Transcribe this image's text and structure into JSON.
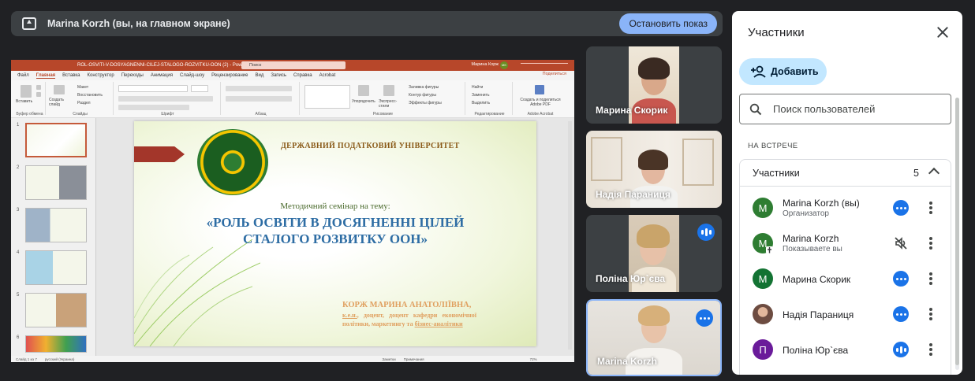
{
  "presenting_bar": {
    "text": "Marina Korzh (вы, на главном экране)",
    "stop_button": "Остановить показ"
  },
  "shared_screen": {
    "window_title": "ROL-OSVITI-V-DOSYAGNENNI-CILEJ-STALOGO-ROZVITKU-OON (2)",
    "app_name": "PowerPoint",
    "search_placeholder": "Поиск",
    "user_name": "Марина Корж",
    "user_initials": "MK",
    "share_button": "Поделиться",
    "tabs": [
      "Файл",
      "Главная",
      "Вставка",
      "Конструктор",
      "Переходы",
      "Анимация",
      "Слайд-шоу",
      "Рецензирование",
      "Вид",
      "Запись",
      "Справка",
      "Acrobat"
    ],
    "active_tab": "Главная",
    "ribbon_groups": [
      "Буфер обмена",
      "Слайды",
      "Шрифт",
      "Абзац",
      "Рисование",
      "Редактирование",
      "Adobe Acrobat"
    ],
    "ribbon_items": {
      "paste": "Вставить",
      "new_slide": "Создать слайд",
      "layout": "Макет",
      "reset": "Восстановить",
      "section": "Раздел",
      "arrange": "Упорядочить",
      "styles": "Экспресс-стили",
      "find": "Найти",
      "replace": "Заменить",
      "select": "Выделить",
      "acrobat": "Создать и поделиться Adobe PDF",
      "fill": "Заливка фигуры",
      "outline": "Контур фигуры",
      "effects": "Эффекты фигуры"
    },
    "thumb_numbers": [
      "1",
      "2",
      "3",
      "4",
      "5",
      "6"
    ],
    "slide": {
      "university": "ДЕРЖАВНИЙ ПОДАТКОВИЙ УНІВЕРСИТЕТ",
      "subtitle": "Методичний семінар на тему:",
      "title_line1": "«РОЛЬ ОСВІТИ В ДОСЯГНЕННІ ЦІЛЕЙ",
      "title_line2": "СТАЛОГО РОЗВИТКУ ООН»",
      "author": "КОРЖ МАРИНА АНАТОЛІЇВНА,",
      "degree": "к.е.н.",
      "info": ", доцент, доцент кафедри економічної політики, маркетингу та",
      "department_link": "бізнес-аналітики"
    },
    "status_bar": {
      "slide_info": "Слайд 1 из 7",
      "language": "русский (Украина)",
      "notes": "Заметки",
      "comments": "Примечания",
      "zoom": "72%"
    }
  },
  "tiles": [
    {
      "name": "Марина Скорик",
      "indicator": "none"
    },
    {
      "name": "Надія Параниця",
      "indicator": "none"
    },
    {
      "name": "Поліна Юр`єва",
      "indicator": "speaking-bars"
    },
    {
      "name": "Marina Korzh",
      "indicator": "more-dots"
    }
  ],
  "panel": {
    "title": "Участники",
    "add_button": "Добавить",
    "search_placeholder": "Поиск пользователей",
    "section_caption": "НА ВСТРЕЧЕ",
    "group_title": "Участники",
    "group_count": "5",
    "participants": [
      {
        "initial": "M",
        "name": "Marina Korzh (вы)",
        "role": "Организатор",
        "avatar_color": "#2e7d32",
        "status": "more-dots"
      },
      {
        "initial": "M",
        "name": "Marina Korzh",
        "role": "Показываете вы",
        "avatar_color": "#2e7d32",
        "status": "muted"
      },
      {
        "initial": "M",
        "name": "Марина Скорик",
        "role": "",
        "avatar_color": "#137333",
        "status": "more-dots"
      },
      {
        "initial": "",
        "name": "Надія Параниця",
        "role": "",
        "avatar_color": "#6d4c41",
        "status": "more-dots"
      },
      {
        "initial": "П",
        "name": "Поліна Юр`єва",
        "role": "",
        "avatar_color": "#6a1b9a",
        "status": "speaking-bars"
      }
    ]
  },
  "colors": {
    "accent": "#1a73e8",
    "stop_button": "#8ab4f8",
    "add_button": "#c2e7ff",
    "background": "#202124",
    "powerpoint": "#b7472a"
  }
}
